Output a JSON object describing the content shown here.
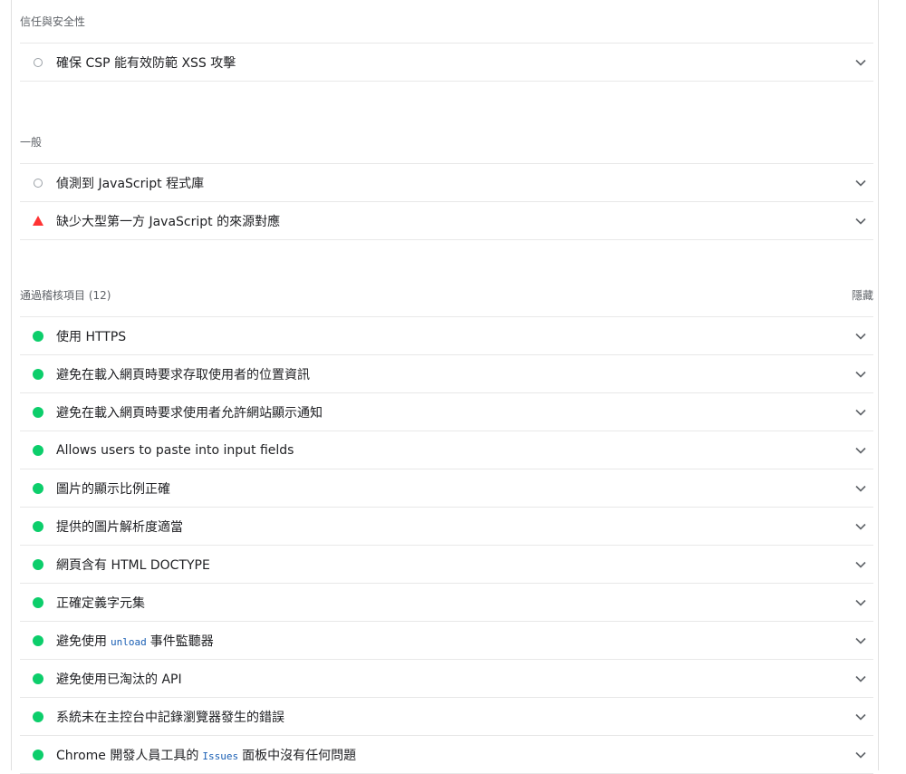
{
  "groups": {
    "trust": {
      "title": "信任與安全性",
      "audits": [
        {
          "status": "na",
          "label": "確保 CSP 能有效防範 XSS 攻擊"
        }
      ]
    },
    "general": {
      "title": "一般",
      "audits": [
        {
          "status": "na",
          "label": "偵測到 JavaScript 程式庫"
        },
        {
          "status": "fail",
          "label": "缺少大型第一方 JavaScript 的來源對應"
        }
      ]
    },
    "passed": {
      "title": "通過稽核項目",
      "count": "(12)",
      "toggle": "隱藏",
      "audits": [
        {
          "status": "pass",
          "label": "使用 HTTPS"
        },
        {
          "status": "pass",
          "label": "避免在載入網頁時要求存取使用者的位置資訊"
        },
        {
          "status": "pass",
          "label": "避免在載入網頁時要求使用者允許網站顯示通知"
        },
        {
          "status": "pass",
          "label": "Allows users to paste into input fields"
        },
        {
          "status": "pass",
          "label": "圖片的顯示比例正確"
        },
        {
          "status": "pass",
          "label": "提供的圖片解析度適當"
        },
        {
          "status": "pass",
          "label": "網頁含有 HTML DOCTYPE"
        },
        {
          "status": "pass",
          "label": "正確定義字元集"
        },
        {
          "status": "pass",
          "label_pre": "避免使用",
          "code": "unload",
          "label_post": "事件監聽器"
        },
        {
          "status": "pass",
          "label": "避免使用已淘汰的 API"
        },
        {
          "status": "pass",
          "label": "系統未在主控台中記錄瀏覽器發生的錯誤"
        },
        {
          "status": "pass",
          "label_pre": "Chrome 開發人員工具的",
          "code": "Issues",
          "label_post": "面板中沒有任何問題"
        }
      ]
    }
  },
  "colors": {
    "pass": "#0cce6b",
    "fail": "#ff3333",
    "na": "#9aa0a6"
  },
  "icons": {
    "pass": "pass-circle-icon",
    "fail": "fail-triangle-icon",
    "na": "info-circle-outline-icon",
    "expand": "chevron-down-icon"
  }
}
